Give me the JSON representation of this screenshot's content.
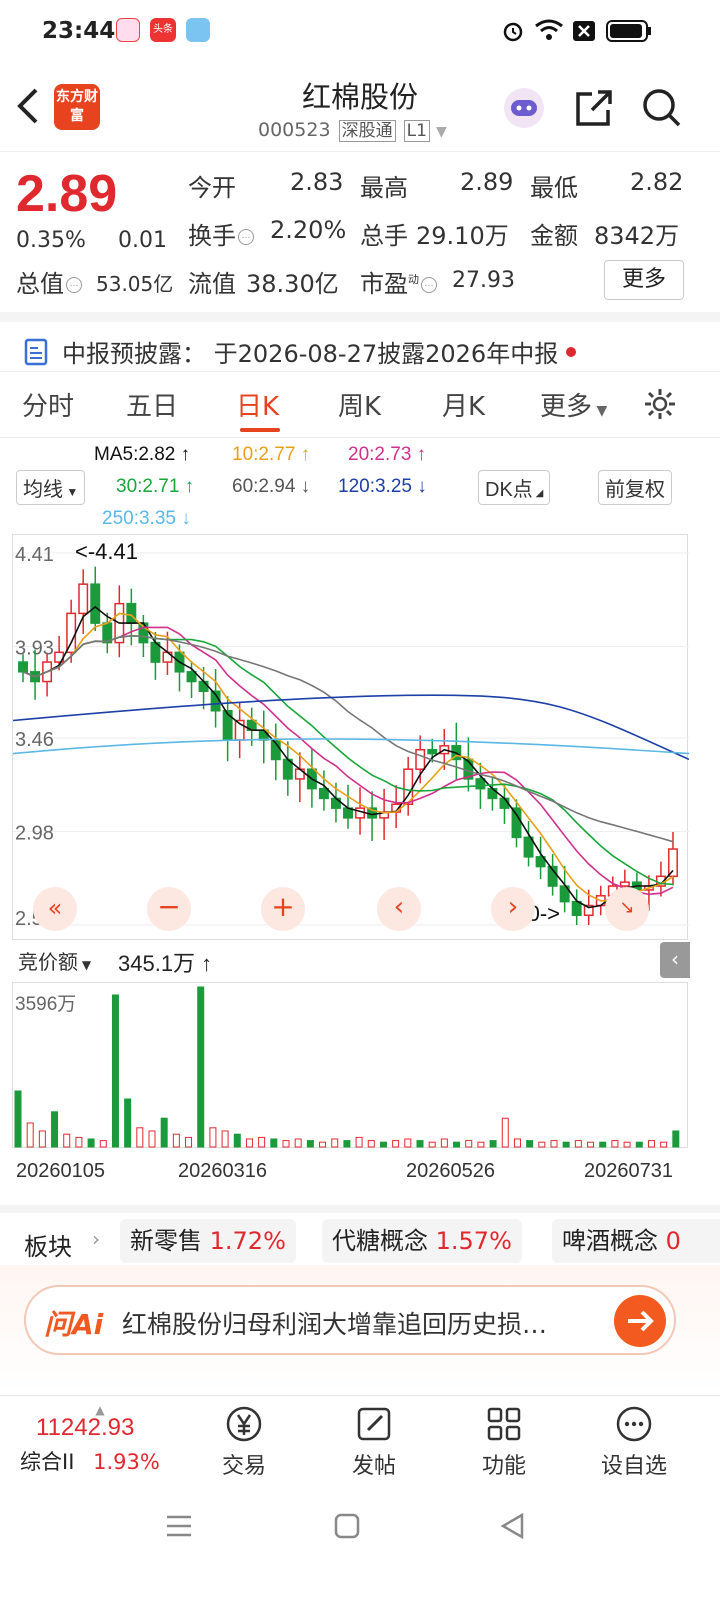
{
  "status_bar": {
    "time": "23:44",
    "app_badge": "头条"
  },
  "header": {
    "logo": "东方财富",
    "title": "红棉股份",
    "code": "000523",
    "tags": [
      "深股通",
      "L1"
    ]
  },
  "quote": {
    "price": "2.89",
    "change_pct": "0.35%",
    "change": "0.01",
    "open_label": "今开",
    "open": "2.83",
    "high_label": "最高",
    "high": "2.89",
    "low_label": "最低",
    "low": "2.82",
    "turnover_label": "换手",
    "turnover": "2.20%",
    "volume_label": "总手",
    "volume": "29.10万",
    "amount_label": "金额",
    "amount": "8342万",
    "mktcap_label": "总值",
    "mktcap": "53.05亿",
    "float_label": "流值",
    "float": "38.30亿",
    "pe_label": "市盈",
    "pe_sup": "动",
    "pe": "27.93",
    "more": "更多"
  },
  "notice": {
    "label": "中报预披露：",
    "text": "于2026-08-27披露2026年中报"
  },
  "tabs": [
    "分时",
    "五日",
    "日K",
    "周K",
    "月K",
    "更多"
  ],
  "active_tab": "日K",
  "ma": {
    "selector": "均线",
    "ma5": "MA5:2.82",
    "ma10": "10:2.77",
    "ma20": "20:2.73",
    "ma30": "30:2.71",
    "ma60": "60:2.94",
    "ma120": "120:3.25",
    "ma250": "250:3.35",
    "dk": "DK点",
    "adjust": "前复权"
  },
  "colors": {
    "ma5": "#111111",
    "ma10": "#e8a01c",
    "ma20": "#d0308c",
    "ma30": "#1aa63a",
    "ma60": "#777777",
    "ma120": "#1c3fa8",
    "ma250": "#5ab7e6",
    "up": "#e0292f",
    "down": "#1a9a3a"
  },
  "chart_data": {
    "type": "candlestick",
    "y_ticks": [
      "4.41",
      "3.93",
      "3.46",
      "2.98",
      "2.50"
    ],
    "ylim": [
      2.5,
      4.41
    ],
    "max_marker": "<-4.41",
    "min_marker": "2.50->",
    "x_labels": [
      "20260105",
      "20260316",
      "20260526",
      "20260731"
    ],
    "close_approx": [
      3.8,
      3.75,
      3.85,
      3.9,
      4.1,
      4.25,
      4.05,
      3.95,
      4.15,
      4.05,
      3.95,
      3.85,
      3.9,
      3.8,
      3.75,
      3.7,
      3.6,
      3.45,
      3.55,
      3.5,
      3.45,
      3.35,
      3.25,
      3.3,
      3.2,
      3.15,
      3.1,
      3.05,
      3.1,
      3.05,
      3.08,
      3.12,
      3.3,
      3.4,
      3.38,
      3.42,
      3.35,
      3.25,
      3.2,
      3.15,
      3.1,
      2.95,
      2.85,
      2.8,
      2.7,
      2.62,
      2.55,
      2.6,
      2.65,
      2.7,
      2.72,
      2.68,
      2.7,
      2.75,
      2.89
    ],
    "volume_top_label": "3596万"
  },
  "volume_bar": {
    "label": "竞价额",
    "value": "345.1万"
  },
  "sectors": {
    "label": "板块",
    "items": [
      {
        "name": "新零售",
        "pct": "1.72%"
      },
      {
        "name": "代糖概念",
        "pct": "1.57%"
      },
      {
        "name": "啤酒概念",
        "pct": "0"
      }
    ]
  },
  "ai": {
    "logo": "问Ai",
    "text": "红棉股份归母利润大增靠追回历史损…"
  },
  "bottom_nav": {
    "index_value": "11242.93",
    "index_name": "综合II",
    "index_pct": "1.93%",
    "items": [
      "交易",
      "发帖",
      "功能",
      "设自选"
    ]
  }
}
